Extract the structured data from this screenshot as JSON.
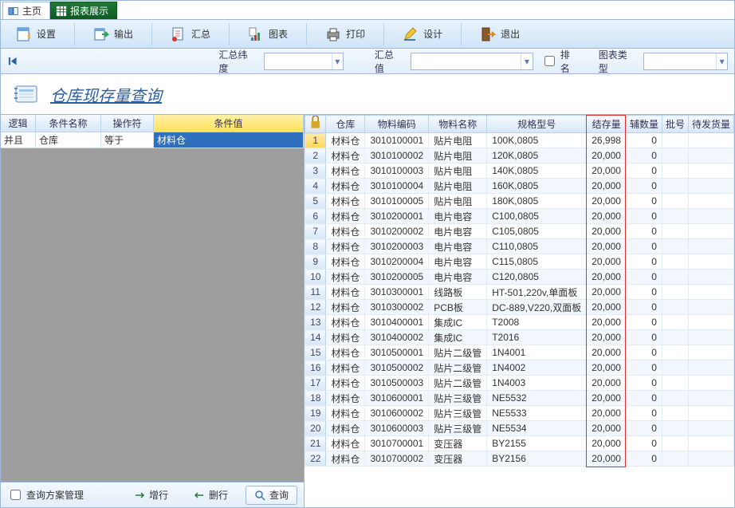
{
  "tabs": {
    "main": {
      "label": "主页"
    },
    "report": {
      "label": "报表展示"
    }
  },
  "toolbar": {
    "settings": "设置",
    "export": "输出",
    "summary": "汇总",
    "chart": "图表",
    "print": "打印",
    "design": "设计",
    "exit": "退出"
  },
  "filter": {
    "dim_label": "汇总纬度",
    "dim_value": "",
    "val_label": "汇总值",
    "val_value": "",
    "rank_label": "排名",
    "rank_checked": false,
    "chart_label": "图表类型",
    "chart_value": ""
  },
  "title": "仓库现存量查询",
  "left": {
    "headers": {
      "logic": "逻辑",
      "cond_name": "条件名称",
      "op": "操作符",
      "value": "条件值"
    },
    "row": {
      "logic": "并且",
      "cond_name": "仓库",
      "op": "等于",
      "value": "材料仓"
    },
    "manage": "查询方案管理",
    "add_row": "增行",
    "del_row": "删行",
    "query": "查询"
  },
  "grid": {
    "headers": {
      "lock": "",
      "warehouse": "仓库",
      "matcode": "物料编码",
      "matname": "物料名称",
      "spec": "规格型号",
      "stock": "结存量",
      "aux": "辅数量",
      "batch": "批号",
      "pending": "待发货量"
    },
    "rows": [
      {
        "wh": "材料仓",
        "code": "3010100001",
        "name": "贴片电阻",
        "spec": "100K,0805",
        "stock": "26,998",
        "aux": "0"
      },
      {
        "wh": "材料仓",
        "code": "3010100002",
        "name": "贴片电阻",
        "spec": "120K,0805",
        "stock": "20,000",
        "aux": "0"
      },
      {
        "wh": "材料仓",
        "code": "3010100003",
        "name": "贴片电阻",
        "spec": "140K,0805",
        "stock": "20,000",
        "aux": "0"
      },
      {
        "wh": "材料仓",
        "code": "3010100004",
        "name": "贴片电阻",
        "spec": "160K,0805",
        "stock": "20,000",
        "aux": "0"
      },
      {
        "wh": "材料仓",
        "code": "3010100005",
        "name": "贴片电阻",
        "spec": "180K,0805",
        "stock": "20,000",
        "aux": "0"
      },
      {
        "wh": "材料仓",
        "code": "3010200001",
        "name": "电片电容",
        "spec": "C100,0805",
        "stock": "20,000",
        "aux": "0"
      },
      {
        "wh": "材料仓",
        "code": "3010200002",
        "name": "电片电容",
        "spec": "C105,0805",
        "stock": "20,000",
        "aux": "0"
      },
      {
        "wh": "材料仓",
        "code": "3010200003",
        "name": "电片电容",
        "spec": "C110,0805",
        "stock": "20,000",
        "aux": "0"
      },
      {
        "wh": "材料仓",
        "code": "3010200004",
        "name": "电片电容",
        "spec": "C115,0805",
        "stock": "20,000",
        "aux": "0"
      },
      {
        "wh": "材料仓",
        "code": "3010200005",
        "name": "电片电容",
        "spec": "C120,0805",
        "stock": "20,000",
        "aux": "0"
      },
      {
        "wh": "材料仓",
        "code": "3010300001",
        "name": "线路板",
        "spec": "HT-501,220v,单面板",
        "stock": "20,000",
        "aux": "0"
      },
      {
        "wh": "材料仓",
        "code": "3010300002",
        "name": "PCB板",
        "spec": "DC-889,V220,双面板",
        "stock": "20,000",
        "aux": "0"
      },
      {
        "wh": "材料仓",
        "code": "3010400001",
        "name": "集成IC",
        "spec": "T2008",
        "stock": "20,000",
        "aux": "0"
      },
      {
        "wh": "材料仓",
        "code": "3010400002",
        "name": "集成IC",
        "spec": "T2016",
        "stock": "20,000",
        "aux": "0"
      },
      {
        "wh": "材料仓",
        "code": "3010500001",
        "name": "贴片二级管",
        "spec": "1N4001",
        "stock": "20,000",
        "aux": "0"
      },
      {
        "wh": "材料仓",
        "code": "3010500002",
        "name": "贴片二级管",
        "spec": "1N4002",
        "stock": "20,000",
        "aux": "0"
      },
      {
        "wh": "材料仓",
        "code": "3010500003",
        "name": "贴片二级管",
        "spec": "1N4003",
        "stock": "20,000",
        "aux": "0"
      },
      {
        "wh": "材料仓",
        "code": "3010600001",
        "name": "贴片三级管",
        "spec": "NE5532",
        "stock": "20,000",
        "aux": "0"
      },
      {
        "wh": "材料仓",
        "code": "3010600002",
        "name": "贴片三级管",
        "spec": "NE5533",
        "stock": "20,000",
        "aux": "0"
      },
      {
        "wh": "材料仓",
        "code": "3010600003",
        "name": "贴片三级管",
        "spec": "NE5534",
        "stock": "20,000",
        "aux": "0"
      },
      {
        "wh": "材料仓",
        "code": "3010700001",
        "name": "变压器",
        "spec": "BY2155",
        "stock": "20,000",
        "aux": "0"
      },
      {
        "wh": "材料仓",
        "code": "3010700002",
        "name": "变压器",
        "spec": "BY2156",
        "stock": "20,000",
        "aux": "0"
      }
    ]
  }
}
